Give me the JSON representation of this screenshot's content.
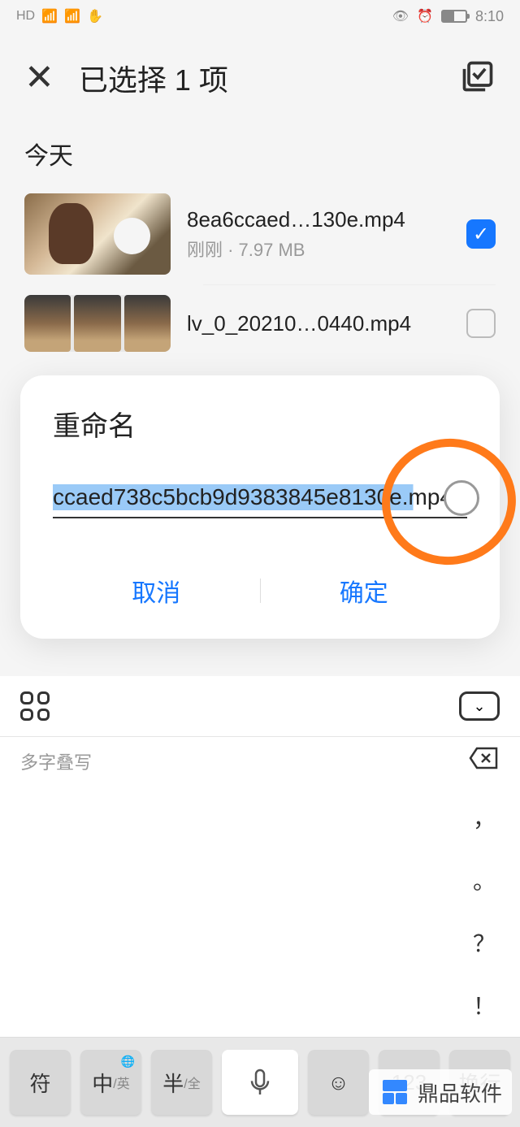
{
  "status": {
    "time": "8:10"
  },
  "header": {
    "title": "已选择 1 项"
  },
  "section": {
    "label": "今天"
  },
  "files": [
    {
      "name": "8ea6ccaed…130e.mp4",
      "meta": "刚刚 · 7.97 MB",
      "checked": true
    },
    {
      "name": "lv_0_20210…0440.mp4",
      "meta": "",
      "checked": false
    }
  ],
  "dialog": {
    "title": "重命名",
    "value": "ccaed738c5bcb9d9383845e8130e.mp4",
    "cancel": "取消",
    "confirm": "确定"
  },
  "ime": {
    "hint": "多字叠写",
    "puncts": [
      "，",
      "。",
      "？",
      "！"
    ],
    "keys": {
      "sym": "符",
      "lang_main": "中",
      "lang_sub": "/英",
      "half_main": "半",
      "half_sub": "/全",
      "num": "123",
      "enter": "换行"
    }
  },
  "watermark": {
    "text": "鼎品软件"
  }
}
